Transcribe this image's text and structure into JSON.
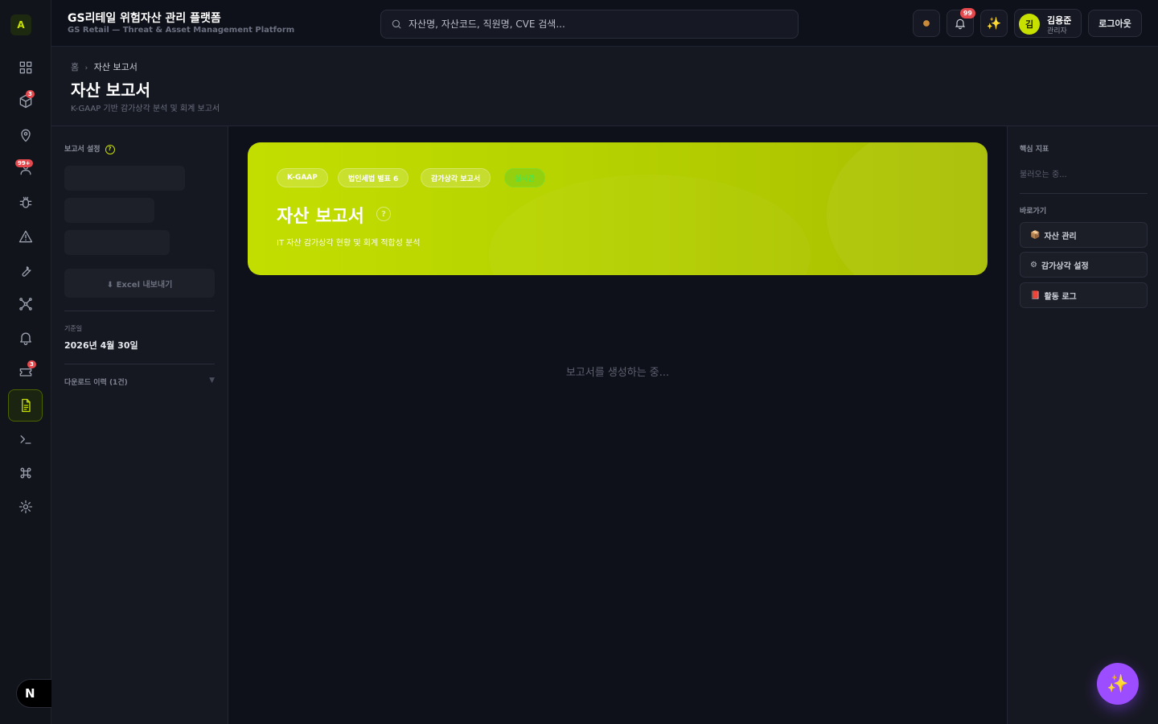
{
  "rail": {
    "logo": "A",
    "badges": {
      "assets": "3",
      "users": "99+",
      "tickets": "3"
    }
  },
  "topbar": {
    "title": "GS리테일 위험자산 관리 플랫폼",
    "subtitle": "GS Retail — Threat & Asset Management Platform",
    "search_placeholder": "자산명, 자산코드, 직원명, CVE 검색...",
    "notif_count": "99",
    "user": {
      "initial": "김",
      "name": "김용준",
      "role": "관리자"
    },
    "logout_label": "로그아웃"
  },
  "page": {
    "breadcrumb_home": "홈",
    "breadcrumb_sep": "›",
    "breadcrumb_current": "자산 보고서",
    "title": "자산 보고서",
    "subtitle": "K-GAAP 기반 감가상각 분석 및 회계 보고서"
  },
  "left_panel": {
    "title": "보고서 설정",
    "help": "?",
    "excel_label": "⬇ Excel 내보내기",
    "base_date_label": "기준일",
    "base_date": "2026년 4월 30일",
    "history_label": "다운로드 이력 (1건)",
    "history_chevron": "▼"
  },
  "hero": {
    "tags": [
      "K-GAAP",
      "법인세법 별표 6",
      "감가상각 보고서",
      "실시간"
    ],
    "title": "자산 보고서",
    "help": "?",
    "subtitle": "IT 자산 감가상각 현황 및 회계 적합성 분석"
  },
  "center": {
    "loading": "보고서를 생성하는 중..."
  },
  "right_panel": {
    "kpi_title": "핵심 지표",
    "kpi_loading": "불러오는 중...",
    "shortcuts_title": "바로가기",
    "shortcuts": [
      {
        "icon": "📦",
        "label": "자산 관리"
      },
      {
        "icon": "⚙",
        "label": "감가상각 설정"
      },
      {
        "icon": "📕",
        "label": "활동 로그"
      }
    ]
  },
  "colors": {
    "accent": "#c8e000",
    "danger": "#e5484d",
    "fab": "#9b4dff"
  }
}
